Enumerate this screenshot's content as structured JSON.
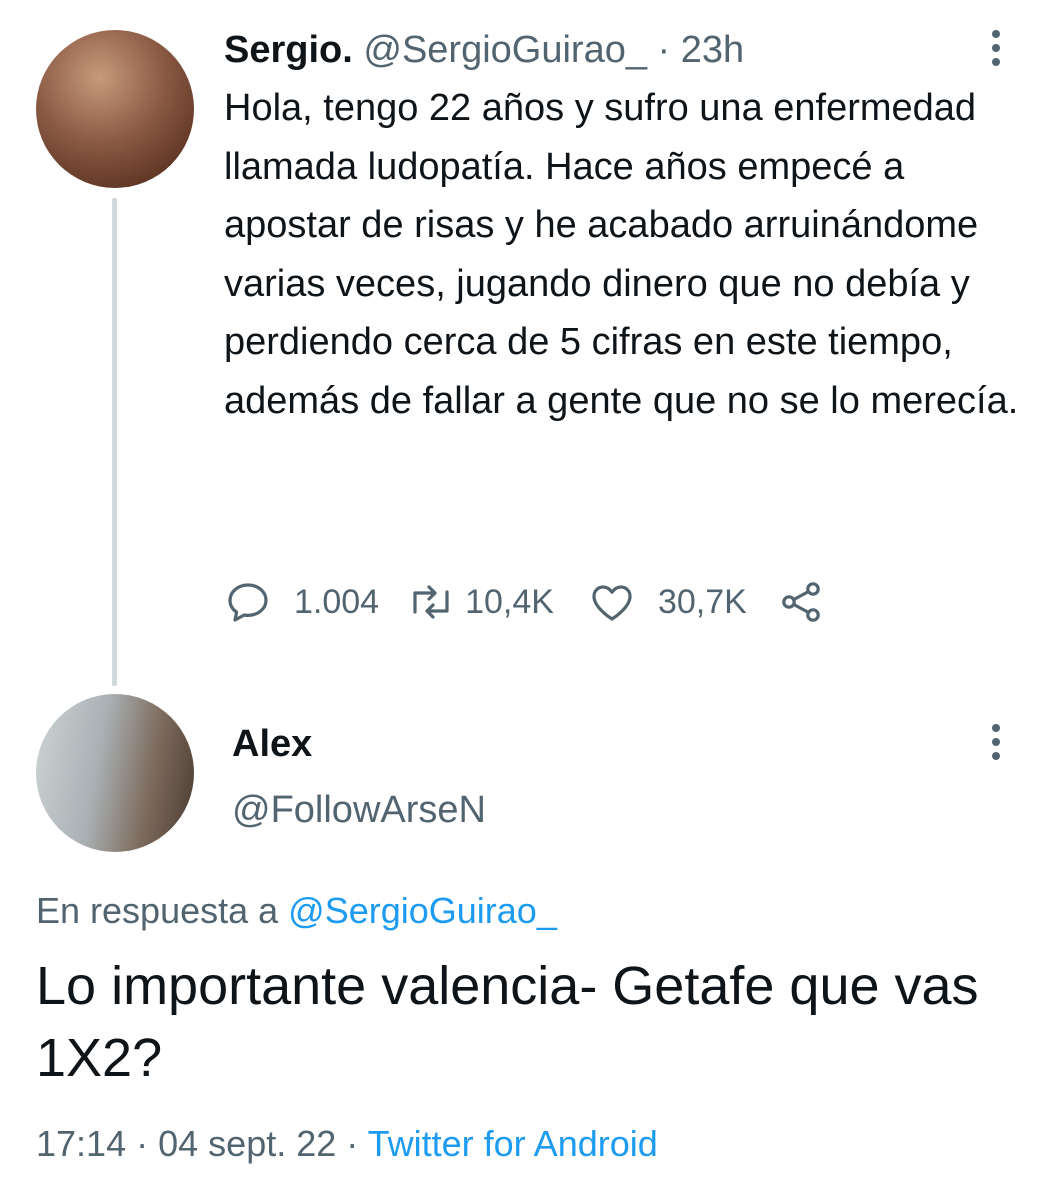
{
  "tweet": {
    "author_name": "Sergio.",
    "author_handle": "@SergioGuirao_",
    "separator": "·",
    "time_ago": "23h",
    "text": "Hola, tengo 22 años y sufro una enfermedad llamada ludopatía. Hace años empecé a apostar de risas y he acabado arruinándome varias veces, jugando dinero que no debía y perdiendo cerca de 5 cifras en este tiempo, además de fallar a gente que no se lo merecía.",
    "reply_count": "1.004",
    "retweet_count": "10,4K",
    "like_count": "30,7K",
    "icons": {
      "reply": "reply-icon",
      "retweet": "retweet-icon",
      "like": "heart-icon",
      "share": "share-icon",
      "more": "more-vertical-icon"
    }
  },
  "reply": {
    "author_name": "Alex",
    "author_handle": "@FollowArseN",
    "in_reply_to_label": "En respuesta a",
    "in_reply_to_handle": "@SergioGuirao_",
    "text": "Lo importante valencia- Getafe que vas 1X2?",
    "time": "17:14",
    "separator1": "·",
    "date": "04 sept. 22",
    "separator2": "·",
    "source": "Twitter for Android"
  },
  "colors": {
    "primary_text": "#0f1419",
    "secondary_text": "#536471",
    "link": "#1d9bf0",
    "thread_line": "#cfd9de"
  }
}
